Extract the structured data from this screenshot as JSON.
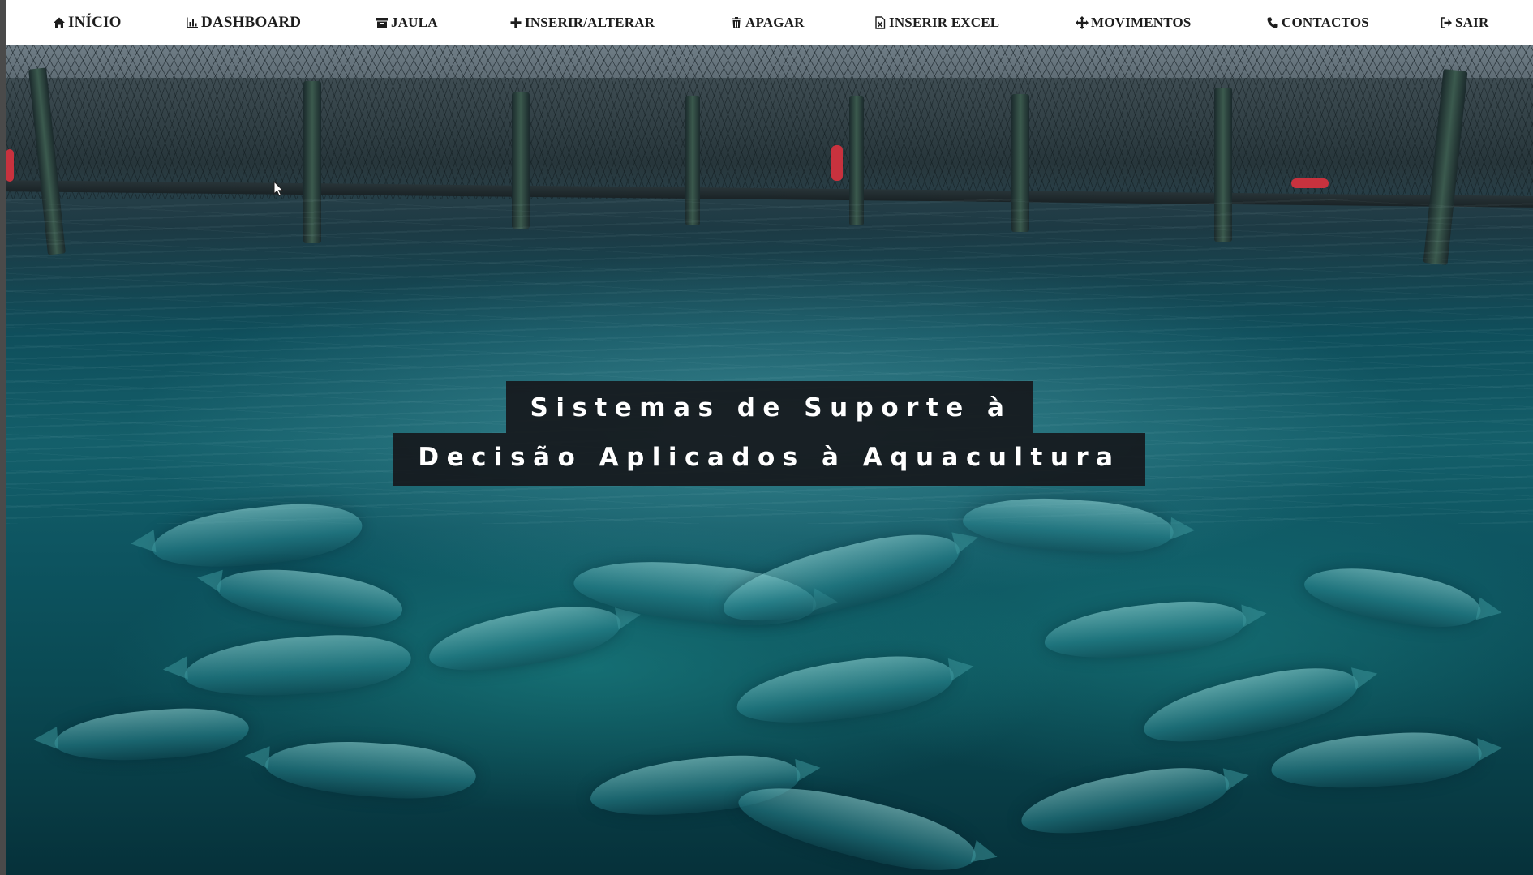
{
  "nav": {
    "items": [
      {
        "label": "INÍCIO",
        "icon": "home-icon"
      },
      {
        "label": "DASHBOARD",
        "icon": "bar-chart-icon"
      },
      {
        "label": "JAULA",
        "icon": "box-icon"
      },
      {
        "label": "INSERIR/ALTERAR",
        "icon": "plus-icon"
      },
      {
        "label": "APAGAR",
        "icon": "trash-icon"
      },
      {
        "label": "INSERIR EXCEL",
        "icon": "file-excel-icon"
      },
      {
        "label": "MOVIMENTOS",
        "icon": "move-icon"
      },
      {
        "label": "CONTACTOS",
        "icon": "phone-icon"
      },
      {
        "label": "SAIR",
        "icon": "logout-icon"
      }
    ]
  },
  "hero": {
    "title_line1": "Sistemas de Suporte à",
    "title_line2": "Decisão Aplicados à Aquacultura"
  },
  "colors": {
    "navbar_bg": "#ffffff",
    "nav_text": "#1d1d1d",
    "title_box": "#16181c",
    "water": "#0f4f5c"
  }
}
